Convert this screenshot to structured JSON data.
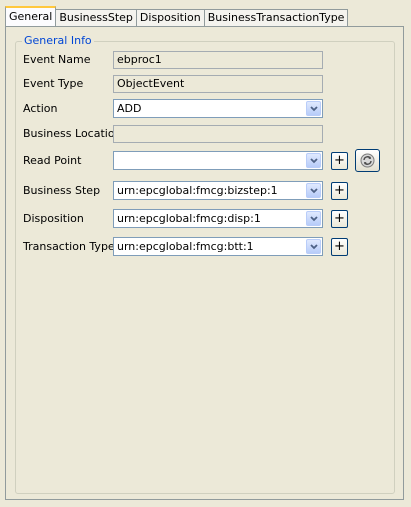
{
  "tabs": [
    {
      "label": "General",
      "active": true
    },
    {
      "label": "BusinessStep",
      "active": false
    },
    {
      "label": "Disposition",
      "active": false
    },
    {
      "label": "BusinessTransactionType",
      "active": false
    }
  ],
  "group": {
    "title": "General Info"
  },
  "form": {
    "event_name": {
      "label": "Event Name",
      "value": "ebproc1"
    },
    "event_type": {
      "label": "Event Type",
      "value": "ObjectEvent"
    },
    "action": {
      "label": "Action",
      "value": "ADD"
    },
    "business_location": {
      "label": "Business Location",
      "value": ""
    },
    "read_point": {
      "label": "Read Point",
      "value": ""
    },
    "business_step": {
      "label": "Business Step",
      "value": "urn:epcglobal:fmcg:bizstep:1"
    },
    "disposition": {
      "label": "Disposition",
      "value": "urn:epcglobal:fmcg:disp:1"
    },
    "transaction_type": {
      "label": "Transaction Type",
      "value": "urn:epcglobal:fmcg:btt:1"
    }
  },
  "buttons": {
    "add_label": "+"
  },
  "icons": {
    "dropdown": "chevron-down-icon",
    "refresh": "refresh-icon"
  },
  "colors": {
    "accent_title": "#0046d5",
    "active_tab_highlight": "#ffc83c",
    "background": "#ece9d8"
  }
}
